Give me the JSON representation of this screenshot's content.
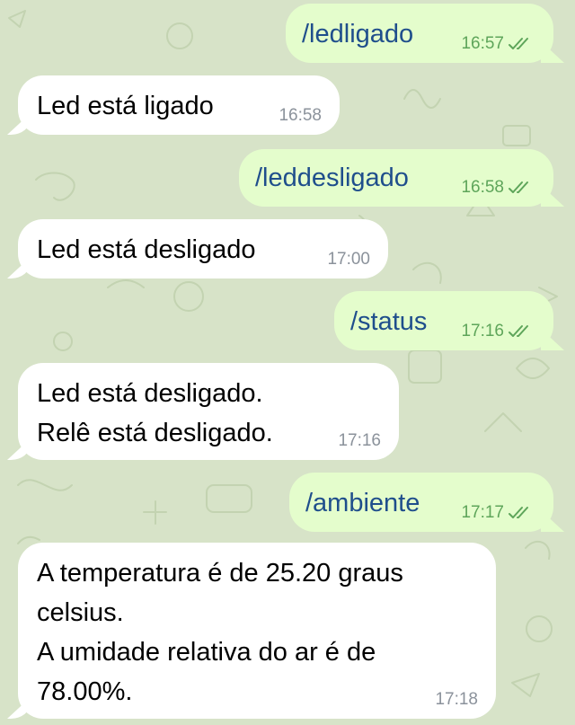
{
  "colors": {
    "background": "#d7e3c8",
    "incoming_bubble": "#ffffff",
    "outgoing_bubble": "#e4fdcc",
    "outgoing_text": "#1f4e8c",
    "read_check": "#5ea55a",
    "timestamp": "#8b929b"
  },
  "messages": [
    {
      "direction": "outgoing",
      "text": "/ledligado",
      "time": "16:57",
      "status": "read",
      "icon": "double-check-icon"
    },
    {
      "direction": "incoming",
      "text": "Led está ligado",
      "time": "16:58"
    },
    {
      "direction": "outgoing",
      "text": "/leddesligado",
      "time": "16:58",
      "status": "read",
      "icon": "double-check-icon"
    },
    {
      "direction": "incoming",
      "text": "Led está desligado",
      "time": "17:00"
    },
    {
      "direction": "outgoing",
      "text": "/status",
      "time": "17:16",
      "status": "read",
      "icon": "double-check-icon"
    },
    {
      "direction": "incoming",
      "text": "Led está desligado.\nRelê está desligado.",
      "time": "17:16"
    },
    {
      "direction": "outgoing",
      "text": "/ambiente",
      "time": "17:17",
      "status": "read",
      "icon": "double-check-icon"
    },
    {
      "direction": "incoming",
      "text": "A temperatura é de 25.20 graus\ncelsius.\nA umidade relativa do ar é de\n78.00%.",
      "time": "17:18"
    }
  ]
}
